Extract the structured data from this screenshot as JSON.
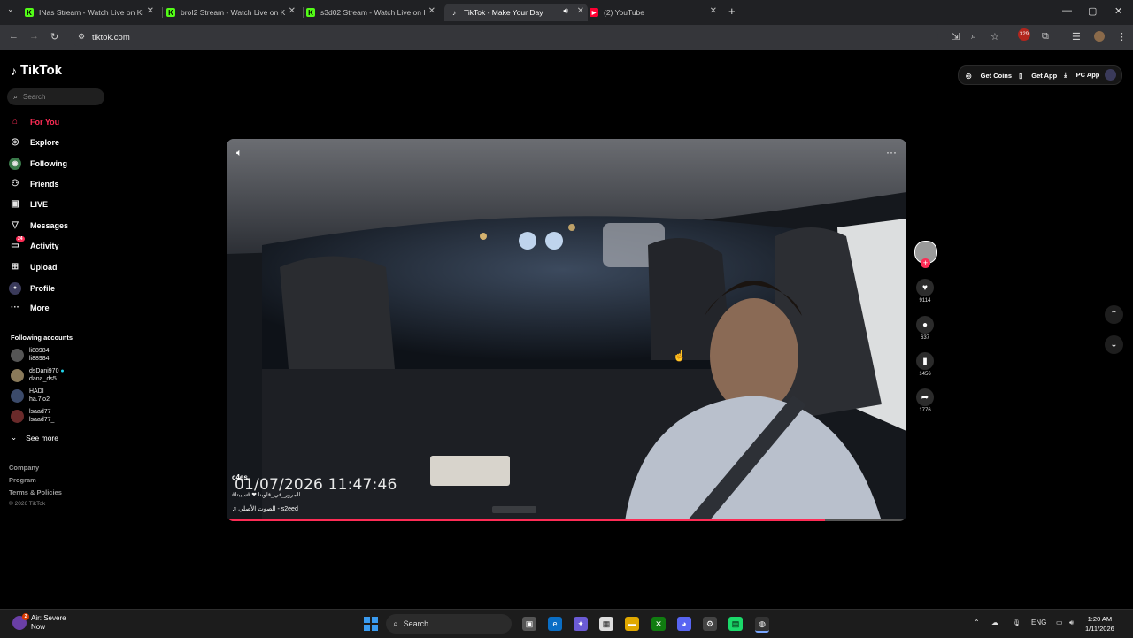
{
  "browser": {
    "tabs": [
      {
        "title": "INas Stream - Watch Live on Ki",
        "icon": "kick-icon"
      },
      {
        "title": "broI2 Stream - Watch Live on K",
        "icon": "kick-icon"
      },
      {
        "title": "s3d02 Stream - Watch Live on I",
        "icon": "kick-icon"
      },
      {
        "title": "TikTok - Make Your Day",
        "icon": "tiktok-icon",
        "active": true
      },
      {
        "title": "(2) YouTube",
        "icon": "youtube-icon"
      }
    ],
    "url": "tiktok.com",
    "extension_badge": "329"
  },
  "sidebar": {
    "logo": "TikTok",
    "search_placeholder": "Search",
    "nav": [
      {
        "label": "For You",
        "icon": "home-icon",
        "active": true
      },
      {
        "label": "Explore",
        "icon": "compass-icon"
      },
      {
        "label": "Following",
        "icon": "following-icon"
      },
      {
        "label": "Friends",
        "icon": "friends-icon"
      },
      {
        "label": "LIVE",
        "icon": "live-icon"
      },
      {
        "label": "Messages",
        "icon": "messages-icon"
      },
      {
        "label": "Activity",
        "icon": "activity-icon",
        "badge": "24"
      },
      {
        "label": "Upload",
        "icon": "upload-icon"
      },
      {
        "label": "Profile",
        "icon": "profile-icon"
      },
      {
        "label": "More",
        "icon": "more-icon"
      }
    ],
    "following_title": "Following accounts",
    "accounts": [
      {
        "display": "li88984",
        "handle": "li88984"
      },
      {
        "display": "dsDani970",
        "handle": "dana_ds5"
      },
      {
        "display": "HADI",
        "handle": "ha.7io2"
      },
      {
        "display": "lsaad77",
        "handle": "lsaad77_"
      }
    ],
    "see_more": "See more",
    "footer": {
      "company": "Company",
      "program": "Program",
      "terms": "Terms & Policies",
      "copyright": "© 2026 TikTok"
    }
  },
  "top_buttons": {
    "coins": "Get Coins",
    "app": "Get App",
    "pc": "PC App"
  },
  "video": {
    "timestamp": "01/07/2026  11:47:46",
    "username": "c4es",
    "hashtags": "#المرور_في_قلوبنا ❤ #سيبتا",
    "music": "الصوت الأصلي - s2eed",
    "progress": 0.88
  },
  "actions": {
    "likes": "9114",
    "comments": "637",
    "saves": "1456",
    "shares": "1776"
  },
  "taskbar": {
    "weather_title": "Air: Severe",
    "weather_sub": "Now",
    "weather_badge": "2",
    "search_label": "Search",
    "language": "ENG",
    "time": "1:20 AM",
    "date": "1/11/2026"
  },
  "colors": {
    "accent": "#fe2c55",
    "bg": "#000000",
    "chrome": "#35363a"
  }
}
